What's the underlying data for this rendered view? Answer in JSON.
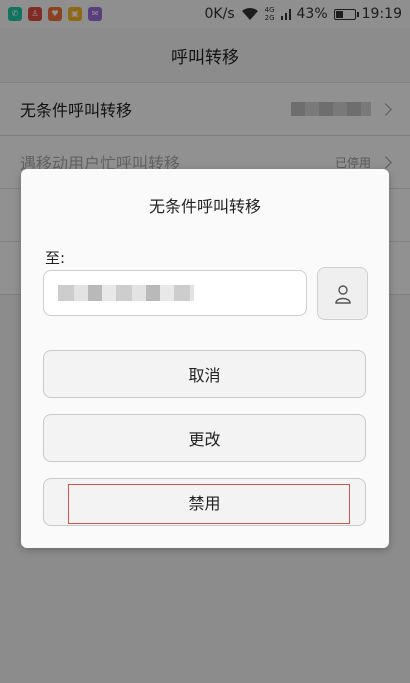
{
  "status_bar": {
    "app_icons": [
      {
        "name": "phone-app-icon",
        "color": "#1ec8a5",
        "glyph": "✆"
      },
      {
        "name": "red-app-icon",
        "color": "#e04a3f",
        "glyph": "♙"
      },
      {
        "name": "orange-app-icon",
        "color": "#f0703a",
        "glyph": "♥"
      },
      {
        "name": "yellow-app-icon",
        "color": "#f4b321",
        "glyph": "▣"
      },
      {
        "name": "purple-app-icon",
        "color": "#9c6bd9",
        "glyph": "✉"
      }
    ],
    "net_speed": "0K/s",
    "network_top": "4G",
    "network_bottom": "2G",
    "battery_percent": "43%",
    "battery_level": 0.43,
    "time": "19:19"
  },
  "screen": {
    "title": "呼叫转移",
    "rows": [
      {
        "label": "无条件呼叫转移",
        "value": ""
      },
      {
        "label": "遇移动用户忙呼叫转移",
        "value": "已停用"
      }
    ]
  },
  "dialog": {
    "title": "无条件呼叫转移",
    "to_label": "至:",
    "number_value": "",
    "cancel_label": "取消",
    "change_label": "更改",
    "disable_label": "禁用"
  }
}
